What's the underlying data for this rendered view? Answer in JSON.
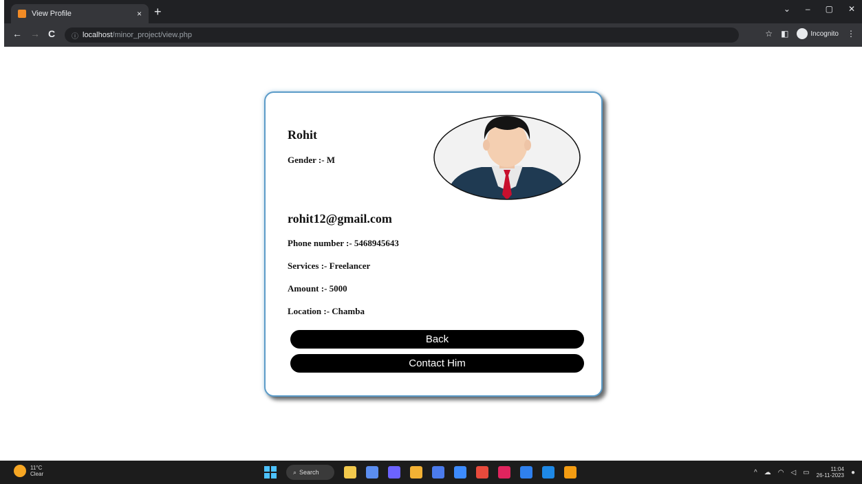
{
  "browser": {
    "tab_title": "View Profile",
    "tab_close": "×",
    "new_tab": "+",
    "url_host": "localhost",
    "url_path": "/minor_project/view.php",
    "incognito_label": "Incognito",
    "back_glyph": "←",
    "forward_glyph": "→",
    "reload_glyph": "C",
    "info_glyph": "ⓘ",
    "star_glyph": "☆",
    "sidepanel_glyph": "◧",
    "menu_glyph": "⋮",
    "minimize_glyph": "–",
    "restore_glyph": "▢",
    "close_glyph": "✕",
    "tabsearch_glyph": "⌄"
  },
  "profile": {
    "name": "Rohit",
    "gender": "Gender :- M",
    "email": "rohit12@gmail.com",
    "phone": "Phone number :- 5468945643",
    "services": "Services :- Freelancer",
    "amount": "Amount :- 5000",
    "location": "Location :- Chamba",
    "back_label": "Back",
    "contact_label": "Contact Him"
  },
  "taskbar": {
    "temperature": "11°C",
    "weather": "Clear",
    "search_label": "Search",
    "time": "11:04",
    "date": "26-11-2023",
    "app_colors": [
      "#f2c94c",
      "#5b8def",
      "#6c63ff",
      "#f2b134",
      "#4b7bec",
      "#3d8bfd",
      "#e84a3c",
      "#e0245e",
      "#2f80ed",
      "#1e88e5",
      "#f39c12"
    ]
  },
  "colors": {
    "card_border": "#5b9bc8",
    "button_bg": "#000000",
    "button_text": "#ffffff"
  }
}
